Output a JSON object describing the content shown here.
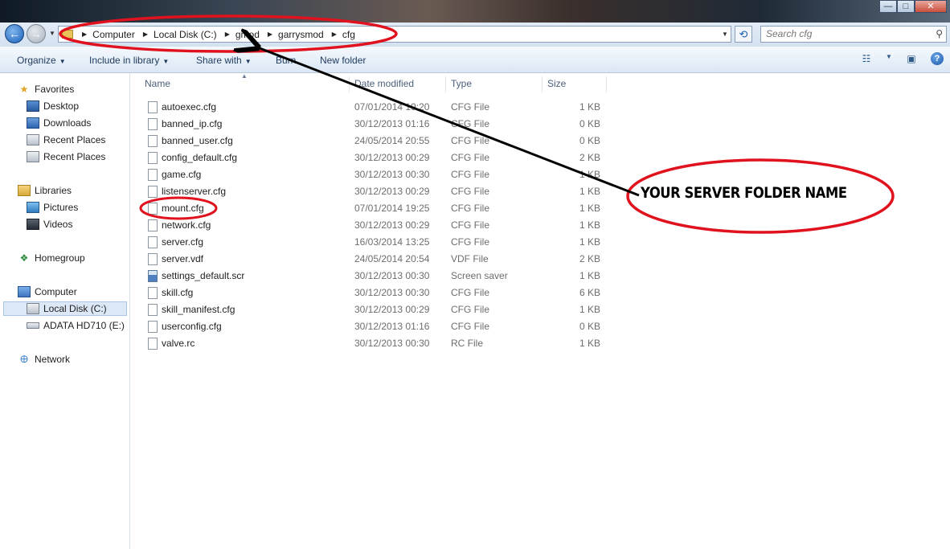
{
  "window": {
    "minimize": "—",
    "maximize": "□",
    "close": "✕"
  },
  "nav": {
    "back": "←",
    "forward": "→"
  },
  "breadcrumb": [
    {
      "label": "Computer"
    },
    {
      "label": "Local Disk (C:)"
    },
    {
      "label": "gmod"
    },
    {
      "label": "garrysmod"
    },
    {
      "label": "cfg"
    }
  ],
  "search": {
    "placeholder": "Search cfg"
  },
  "toolbar": {
    "organize": "Organize",
    "include_in_library": "Include in library",
    "share_with": "Share with",
    "burn": "Burn",
    "new_folder": "New folder",
    "help": "?"
  },
  "sidebar": {
    "favorites": "Favorites",
    "desktop": "Desktop",
    "downloads": "Downloads",
    "recent_places_1": "Recent Places",
    "recent_places_2": "Recent Places",
    "libraries": "Libraries",
    "pictures": "Pictures",
    "videos": "Videos",
    "homegroup": "Homegroup",
    "computer": "Computer",
    "local_disk": "Local Disk (C:)",
    "adata": "ADATA HD710 (E:)",
    "network": "Network"
  },
  "columns": {
    "name": "Name",
    "date_modified": "Date modified",
    "type": "Type",
    "size": "Size"
  },
  "files": [
    {
      "name": "autoexec.cfg",
      "date": "07/01/2014 19:20",
      "type": "CFG File",
      "size": "1 KB"
    },
    {
      "name": "banned_ip.cfg",
      "date": "30/12/2013 01:16",
      "type": "CFG File",
      "size": "0 KB"
    },
    {
      "name": "banned_user.cfg",
      "date": "24/05/2014 20:55",
      "type": "CFG File",
      "size": "0 KB"
    },
    {
      "name": "config_default.cfg",
      "date": "30/12/2013 00:29",
      "type": "CFG File",
      "size": "2 KB"
    },
    {
      "name": "game.cfg",
      "date": "30/12/2013 00:30",
      "type": "CFG File",
      "size": "1 KB"
    },
    {
      "name": "listenserver.cfg",
      "date": "30/12/2013 00:29",
      "type": "CFG File",
      "size": "1 KB"
    },
    {
      "name": "mount.cfg",
      "date": "07/01/2014 19:25",
      "type": "CFG File",
      "size": "1 KB"
    },
    {
      "name": "network.cfg",
      "date": "30/12/2013 00:29",
      "type": "CFG File",
      "size": "1 KB"
    },
    {
      "name": "server.cfg",
      "date": "16/03/2014 13:25",
      "type": "CFG File",
      "size": "1 KB"
    },
    {
      "name": "server.vdf",
      "date": "24/05/2014 20:54",
      "type": "VDF File",
      "size": "2 KB"
    },
    {
      "name": "settings_default.scr",
      "date": "30/12/2013 00:30",
      "type": "Screen saver",
      "size": "1 KB"
    },
    {
      "name": "skill.cfg",
      "date": "30/12/2013 00:30",
      "type": "CFG File",
      "size": "6 KB"
    },
    {
      "name": "skill_manifest.cfg",
      "date": "30/12/2013 00:29",
      "type": "CFG File",
      "size": "1 KB"
    },
    {
      "name": "userconfig.cfg",
      "date": "30/12/2013 01:16",
      "type": "CFG File",
      "size": "0 KB"
    },
    {
      "name": "valve.rc",
      "date": "30/12/2013 00:30",
      "type": "RC File",
      "size": "1 KB"
    }
  ],
  "annotation": {
    "text": "YOUR SERVER FOLDER NAME",
    "color": "#e0121e"
  }
}
